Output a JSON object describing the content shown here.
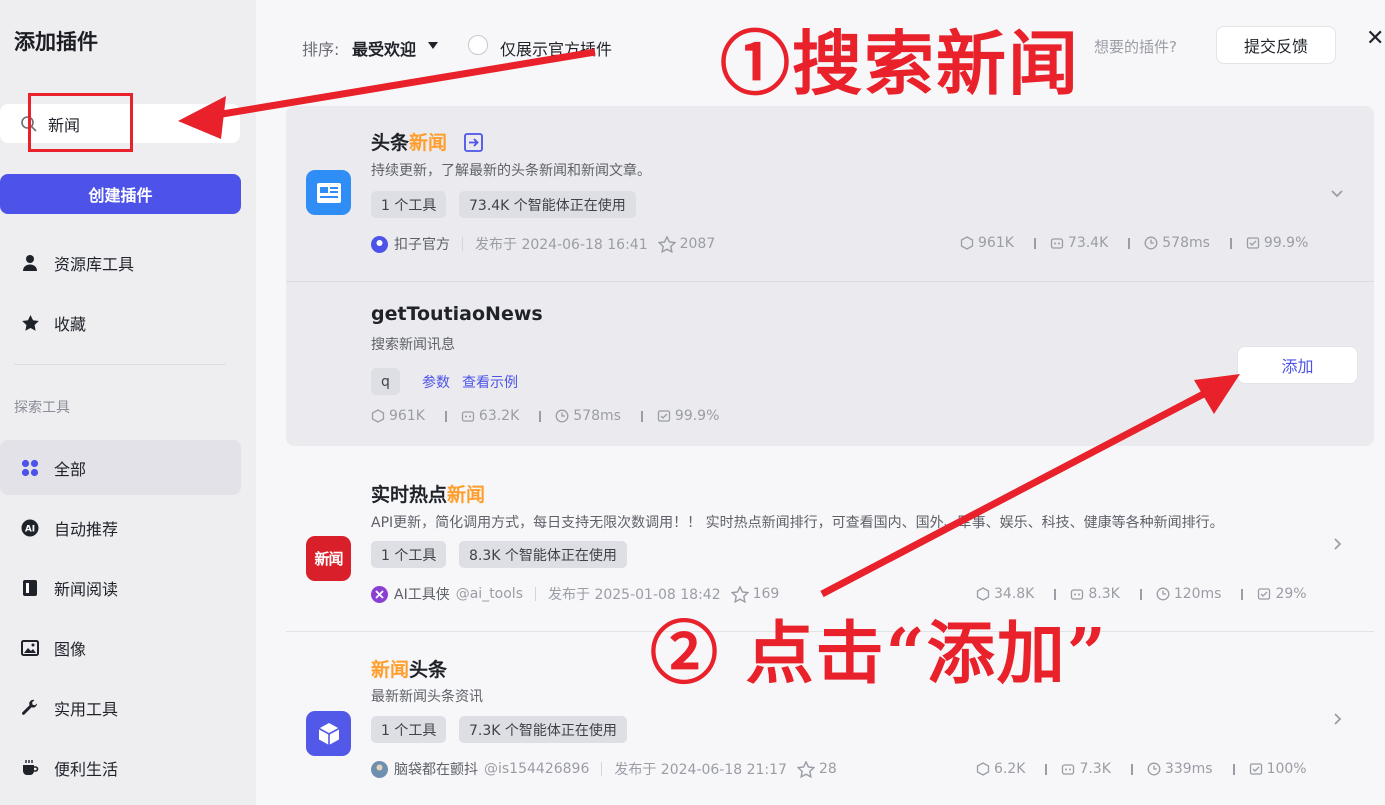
{
  "sidebar": {
    "title": "添加插件",
    "search_value": "新闻",
    "create_label": "创建插件",
    "items_top": [
      {
        "label": "资源库工具",
        "icon": "person-icon"
      },
      {
        "label": "收藏",
        "icon": "star-icon"
      }
    ],
    "section_label": "探索工具",
    "items": [
      {
        "label": "全部",
        "icon": "grid-icon"
      },
      {
        "label": "自动推荐",
        "icon": "ai-icon"
      },
      {
        "label": "新闻阅读",
        "icon": "book-icon"
      },
      {
        "label": "图像",
        "icon": "image-icon"
      },
      {
        "label": "实用工具",
        "icon": "wrench-icon"
      },
      {
        "label": "便利生活",
        "icon": "coffee-icon"
      }
    ]
  },
  "topbar": {
    "sort_label": "排序:",
    "sort_value": "最受欢迎",
    "official_only": "仅展示官方插件",
    "wanted_text": "想要的插件?",
    "feedback": "提交反馈"
  },
  "cards": [
    {
      "title_prefix": "头条",
      "title_hl": "新闻",
      "desc": "持续更新，了解最新的头条新闻和新闻文章。",
      "tags": [
        "1 个工具",
        "73.4K 个智能体正在使用"
      ],
      "author": "扣子官方",
      "published": "发布于 2024-06-18 16:41",
      "favorites": "2087",
      "stats": [
        "961K",
        "73.4K",
        "578ms",
        "99.9%"
      ],
      "icon_color": "#2f8ef5"
    },
    {
      "title": "getToutiaoNews",
      "desc": "搜索新闻讯息",
      "param": "q",
      "link_params": "参数",
      "link_examples": "查看示例",
      "stats": [
        "961K",
        "63.2K",
        "578ms",
        "99.9%"
      ],
      "add_label": "添加"
    },
    {
      "title_prefix": "实时热点",
      "title_hl": "新闻",
      "desc": "API更新，简化调用方式，每日支持无限次数调用！！ 实时热点新闻排行，可查看国内、国外、军事、娱乐、科技、健康等各种新闻排行。",
      "tags": [
        "1 个工具",
        "8.3K 个智能体正在使用"
      ],
      "author": "AI工具侠",
      "handle": "@ai_tools",
      "published": "发布于 2025-01-08 18:42",
      "favorites": "169",
      "stats": [
        "34.8K",
        "8.3K",
        "120ms",
        "29%"
      ],
      "icon_text": "新闻",
      "icon_color": "#d9202a"
    },
    {
      "title_hl": "新闻",
      "title_suffix": "头条",
      "desc": "最新新闻头条资讯",
      "tags": [
        "1 个工具",
        "7.3K 个智能体正在使用"
      ],
      "author": "脑袋都在颤抖",
      "handle": "@is154426896",
      "published": "发布于 2024-06-18 21:17",
      "favorites": "28",
      "stats": [
        "6.2K",
        "7.3K",
        "339ms",
        "100%"
      ],
      "icon_color": "#5258e8"
    }
  ],
  "annotations": {
    "step1": "①搜索新闻",
    "step2": "② 点击“添加”",
    "color": "#e8212b"
  }
}
